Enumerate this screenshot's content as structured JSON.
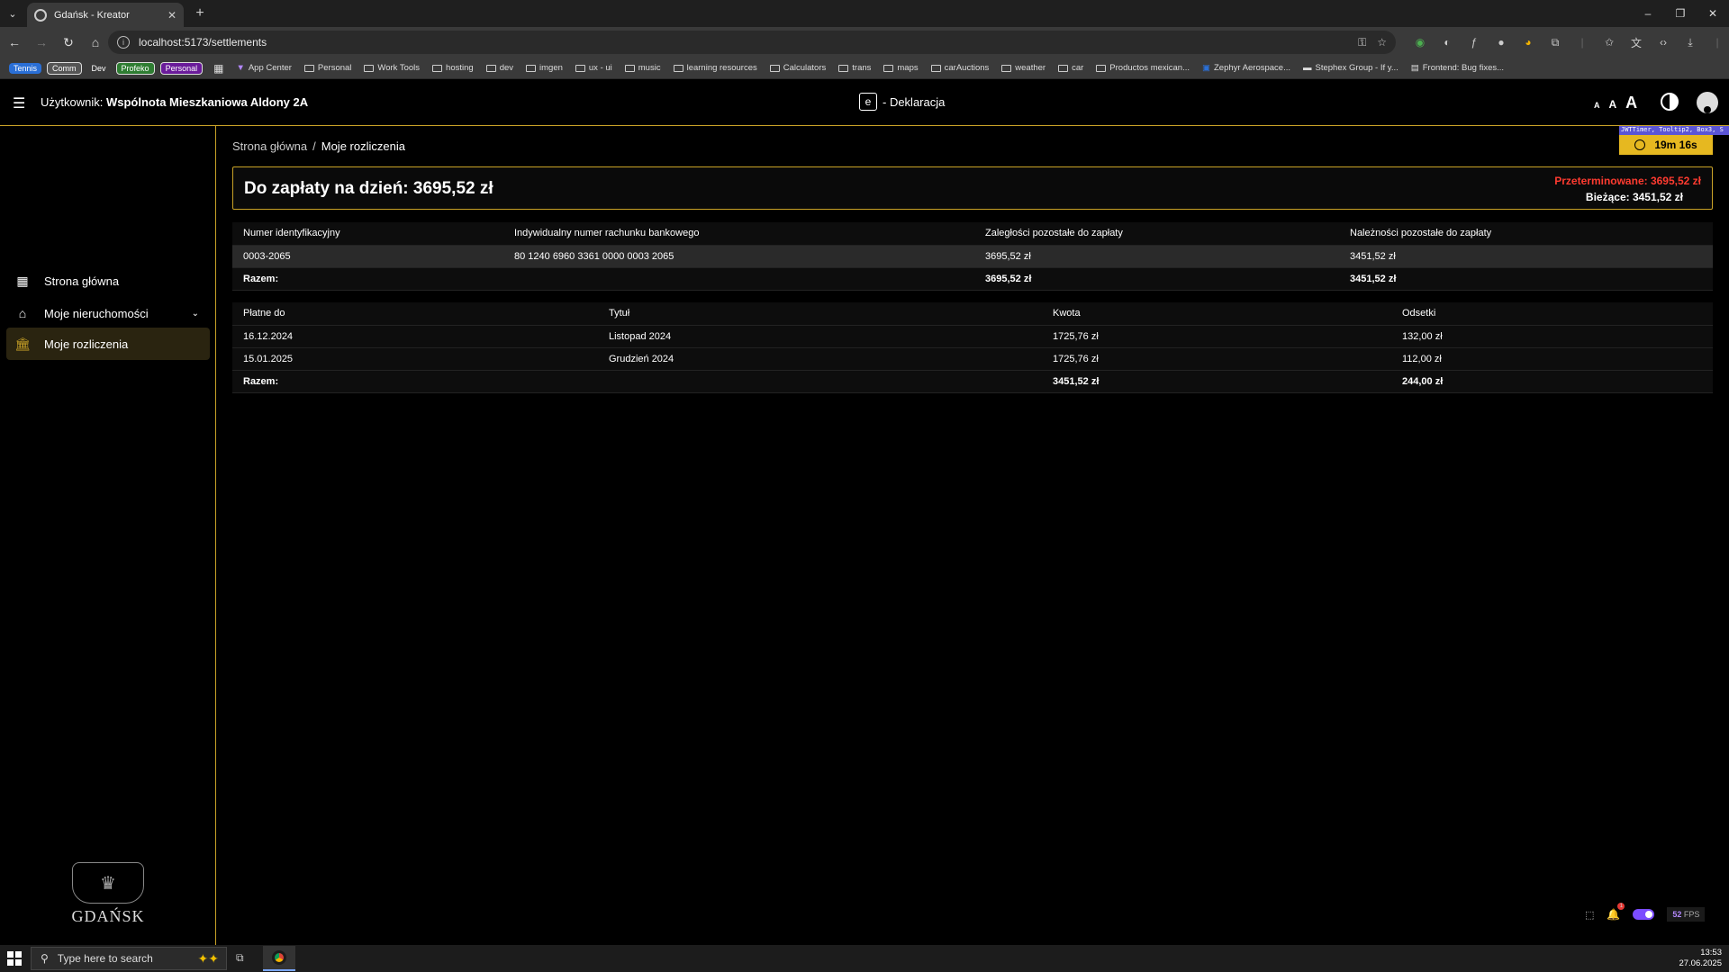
{
  "browser": {
    "tab_title": "Gdańsk - Kreator",
    "url": "localhost:5173/settlements",
    "bookmark_pills": [
      {
        "label": "Tennis",
        "color": "#2a6fd6"
      },
      {
        "label": "Comm",
        "color": "#555555"
      },
      {
        "label": "Dev",
        "color": "#3a3a3a"
      },
      {
        "label": "Profeko",
        "color": "#2e7d32"
      },
      {
        "label": "Personal",
        "color": "#6a1b9a"
      }
    ],
    "bookmarks": [
      "App Center",
      "Personal",
      "Work Tools",
      "hosting",
      "dev",
      "imgen",
      "ux - ui",
      "music",
      "learning resources",
      "Calculators",
      "trans",
      "maps",
      "carAuctions",
      "weather",
      "car",
      "Productos mexican...",
      "Zephyr Aerospace...",
      "Stephex Group - If y...",
      "Frontend: Bug fixes..."
    ]
  },
  "header": {
    "user_prefix": "Użytkownik:",
    "user_name": "Wspólnota Mieszkaniowa Aldony 2A",
    "brand_letter": "e",
    "brand_text": "- Deklaracja",
    "font_sizes": [
      "A",
      "A",
      "A"
    ]
  },
  "sidebar": {
    "items": [
      {
        "label": "Strona główna",
        "icon": "dashboard-icon"
      },
      {
        "label": "Moje nieruchomości",
        "icon": "house-icon"
      },
      {
        "label": "Moje rozliczenia",
        "icon": "bank-icon"
      }
    ],
    "logo_text": "GDAŃSK"
  },
  "breadcrumb": {
    "home": "Strona główna",
    "sep": "/",
    "current": "Moje rozliczenia"
  },
  "timer": {
    "tag": "JWTTimer, Tooltip2, Box3, S",
    "value": "19m 16s"
  },
  "summary": {
    "due": "Do zapłaty na dzień: 3695,52 zł",
    "overdue": "Przeterminowane: 3695,52 zł",
    "current": "Bieżące: 3451,52 zł"
  },
  "accounts_table": {
    "headers": [
      "Numer identyfikacyjny",
      "Indywidualny numer rachunku bankowego",
      "Zaległości pozostałe do zapłaty",
      "Należności pozostałe do zapłaty"
    ],
    "rows": [
      [
        "0003-2065",
        "80 1240 6960 3361 0000 0003 2065",
        "3695,52 zł",
        "3451,52 zł"
      ]
    ],
    "total": [
      "Razem:",
      "",
      "3695,52 zł",
      "3451,52 zł"
    ]
  },
  "payments_table": {
    "headers": [
      "Płatne do",
      "Tytuł",
      "Kwota",
      "Odsetki"
    ],
    "rows": [
      [
        "16.12.2024",
        "Listopad 2024",
        "1725,76 zł",
        "132,00 zł"
      ],
      [
        "15.01.2025",
        "Grudzień 2024",
        "1725,76 zł",
        "112,00 zł"
      ]
    ],
    "total": [
      "Razem:",
      "",
      "3451,52 zł",
      "244,00 zł"
    ]
  },
  "devtools": {
    "badge": "1",
    "fps_value": "52",
    "fps_label": "FPS"
  },
  "taskbar": {
    "search_placeholder": "Type here to search",
    "time": "13:53",
    "date": "27.06.2025"
  }
}
